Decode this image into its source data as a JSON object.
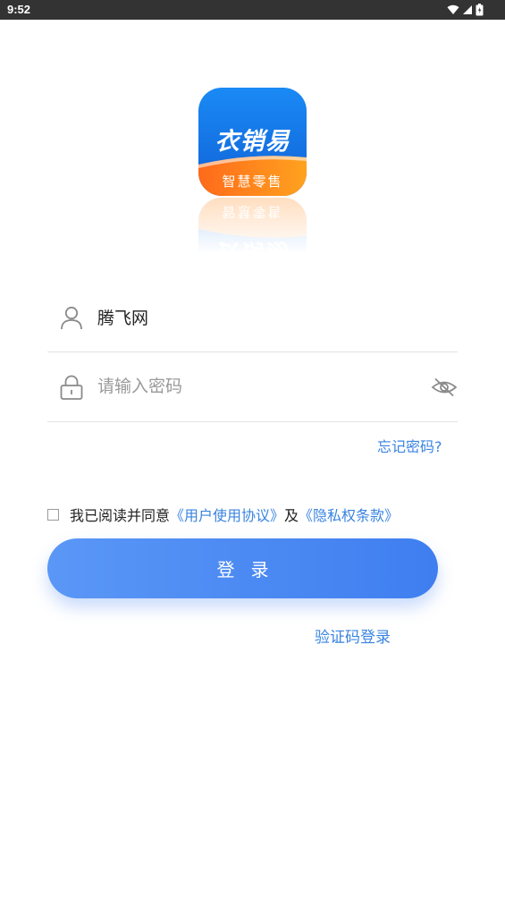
{
  "status_bar": {
    "time": "9:52",
    "icons": [
      "wifi-icon",
      "cell-signal-icon",
      "battery-icon"
    ]
  },
  "logo": {
    "title": "衣销易",
    "subtitle": "智慧零售",
    "colors": {
      "blue_top": "#1a8af5",
      "blue_bottom": "#1061d6",
      "orange": "#ff7a1a",
      "orange_light": "#ffa21f"
    }
  },
  "form": {
    "username": {
      "value": "腾飞网",
      "icon": "user-icon"
    },
    "password": {
      "value": "",
      "placeholder": "请输入密码",
      "icon": "lock-icon",
      "toggle_icon": "eye-hidden-icon"
    },
    "forgot_label": "忘记密码?"
  },
  "agreement": {
    "prefix": "我已阅读并同意",
    "user_agreement": "《用户使用协议》",
    "and": "及",
    "privacy_policy": "《隐私权条款》",
    "checked": false
  },
  "login_button": {
    "label": "登录"
  },
  "alt_login": {
    "label": "验证码登录"
  },
  "colors": {
    "accent": "#3a84e0",
    "button_start": "#5a97f6",
    "button_end": "#3f7ef0"
  }
}
